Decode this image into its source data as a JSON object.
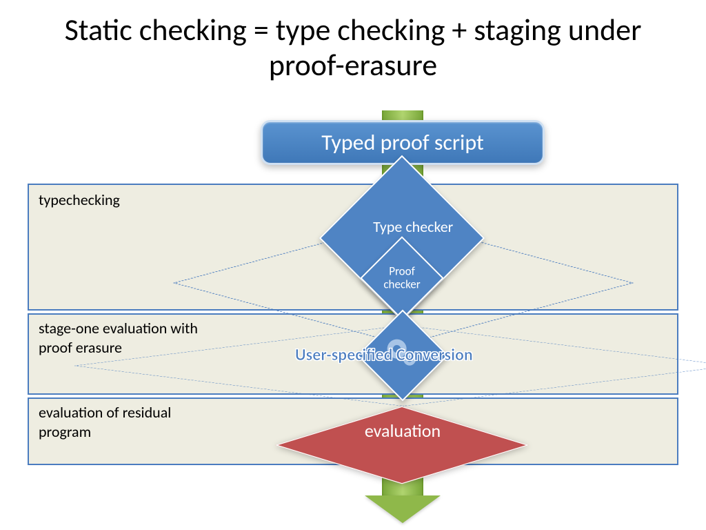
{
  "title": "Static checking = type checking + staging under proof-erasure",
  "flow": {
    "start_box": "Typed proof script",
    "type_checker": "Type checker",
    "proof_checker": "Proof checker",
    "conversion": "User-specified Conversion",
    "evaluation": "evaluation"
  },
  "phases": {
    "typechecking": "typechecking",
    "stage_one": "stage-one evaluation with proof erasure",
    "residual": "evaluation of residual program"
  },
  "colors": {
    "blue": "#4f84c4",
    "red": "#c05050",
    "green": "#8fb84a",
    "panel": "#eeede1",
    "border": "#4a7cbf"
  }
}
